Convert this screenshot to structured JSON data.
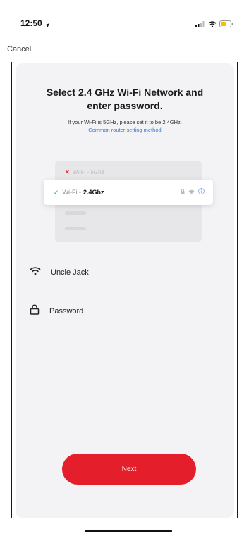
{
  "status_bar": {
    "time": "12:50",
    "icons": [
      "location-arrow-icon",
      "signal-icon",
      "wifi-icon",
      "battery-icon"
    ]
  },
  "nav": {
    "cancel_label": "Cancel"
  },
  "card": {
    "title_line1": "Select 2.4 GHz Wi-Fi Network and",
    "title_line2": "enter password.",
    "subtitle": "If your Wi-Fi is 5GHz, please set it to be 2.4GHz.",
    "help_link": "Common router setting method"
  },
  "illustration": {
    "bad_network_label": "Wi-Fi - 5Ghz",
    "good_network_prefix": "Wi-Fi -",
    "good_network_band": "2.4Ghz"
  },
  "form": {
    "ssid_value": "Uncle Jack",
    "ssid_hint": "",
    "password_placeholder": "Password"
  },
  "actions": {
    "next_label": "Next"
  },
  "colors": {
    "accent": "#e41f2b",
    "link": "#3a7bd5",
    "check": "#2bb673",
    "card_bg": "#f3f3f5"
  }
}
